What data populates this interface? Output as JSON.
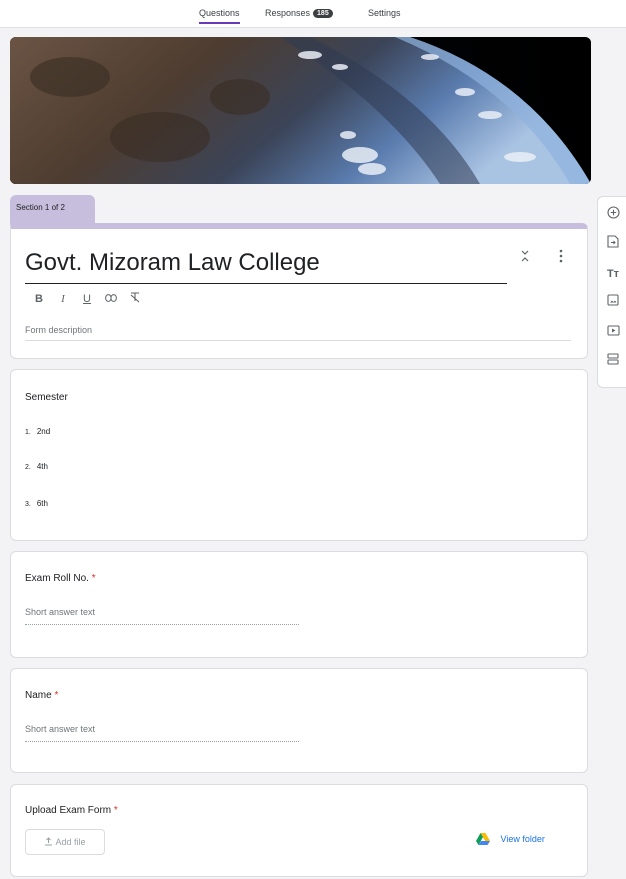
{
  "tabs": {
    "questions": "Questions",
    "responses": "Responses",
    "responses_count": "185",
    "settings": "Settings"
  },
  "section": {
    "label": "Section 1 of 2"
  },
  "form": {
    "title": "Govt. Mizoram Law College",
    "description_placeholder": "Form description",
    "format_buttons": [
      "B",
      "I",
      "U"
    ]
  },
  "questions": [
    {
      "title": "Semester",
      "required": false,
      "options": [
        {
          "num": "1.",
          "label": "2nd"
        },
        {
          "num": "2.",
          "label": "4th"
        },
        {
          "num": "3.",
          "label": "6th"
        }
      ]
    },
    {
      "title": "Exam Roll No.",
      "required": true,
      "placeholder": "Short answer text"
    },
    {
      "title": "Name",
      "required": true,
      "placeholder": "Short answer text"
    },
    {
      "title": "Upload Exam Form",
      "required": true,
      "add_file_label": "Add file",
      "view_folder_label": "View folder"
    }
  ],
  "required_marker": "*",
  "sidetools": [
    "add-question-icon",
    "import-questions-icon",
    "add-title-icon",
    "add-image-icon",
    "add-video-icon",
    "add-section-icon"
  ],
  "sidetools_text": {
    "add_title": "Tт"
  },
  "colors": {
    "accent": "#673ab7",
    "section_tab": "#c7bedd",
    "required": "#d93025",
    "link": "#1a73e8"
  }
}
